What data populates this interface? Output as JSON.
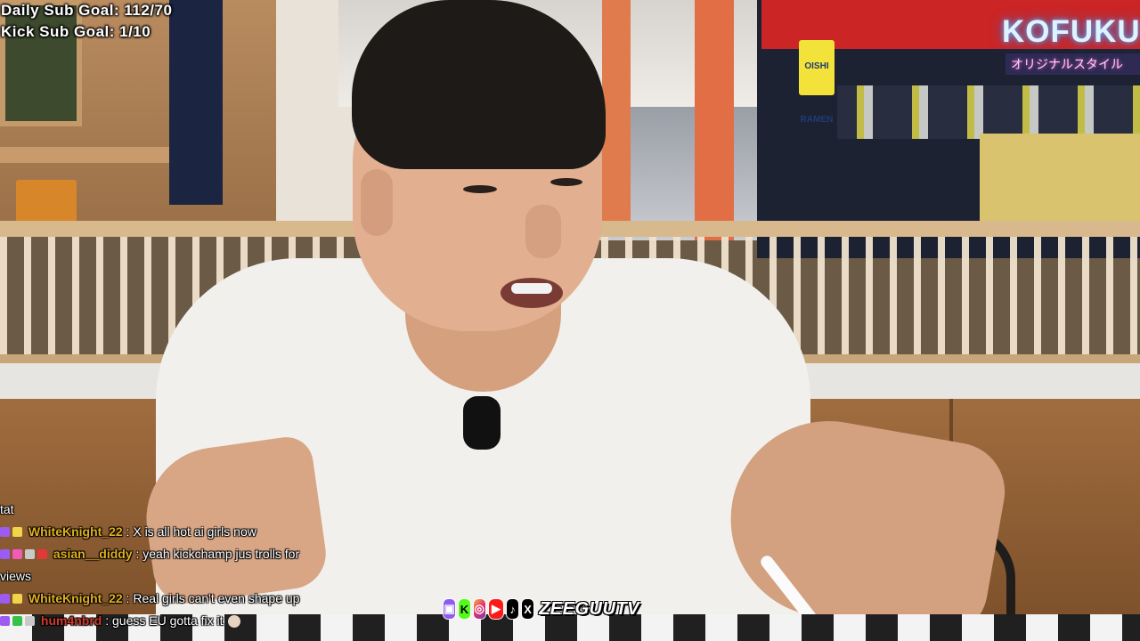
{
  "overlay": {
    "daily_sub_goal": "Daily Sub Goal: 112/70",
    "kick_sub_goal": "Kick Sub Goal: 1/10"
  },
  "store_signs": {
    "kofuku_title": "KOFUKU",
    "kofuku_subtitle": "オリジナルスタイル",
    "ramen_sign": "OISHI RAMEN"
  },
  "chat": {
    "messages": [
      {
        "user": "",
        "text": "tat",
        "name_color": "#ffffff",
        "badges": []
      },
      {
        "user": "WhiteKnight_22",
        "text": " : X is all hot ai girls now",
        "name_color": "#e0b020",
        "badges": [
          "purple",
          "gold"
        ]
      },
      {
        "user": "asian__diddy",
        "text": " : yeah kickchamp jus trolls for",
        "name_color": "#e0b020",
        "badges": [
          "purple",
          "pink",
          "gray",
          "red"
        ]
      },
      {
        "user": "",
        "text": "views",
        "name_color": "#ffffff",
        "badges": []
      },
      {
        "user": "WhiteKnight_22",
        "text": " : Real girls can't even shape up",
        "name_color": "#e0b020",
        "badges": [
          "purple",
          "gold"
        ]
      },
      {
        "user": "hum4nbrd",
        "text": " : guess EU gotta fix it",
        "name_color": "#d13a2c",
        "badges": [
          "purple",
          "green",
          "gray"
        ],
        "emote": "face-emote"
      }
    ]
  },
  "social": {
    "icons": [
      "twitch-icon",
      "kick-icon",
      "instagram-icon",
      "youtube-icon",
      "tiktok-icon",
      "x-icon"
    ],
    "labels": [
      "▣",
      "K",
      "◎",
      "▶",
      "♪",
      "X"
    ],
    "brand": "ZEEGUUTV"
  },
  "colors": {
    "kofuku_neon": "#dff2ff",
    "username_gold": "#e0b020",
    "username_red": "#d13a2c"
  }
}
